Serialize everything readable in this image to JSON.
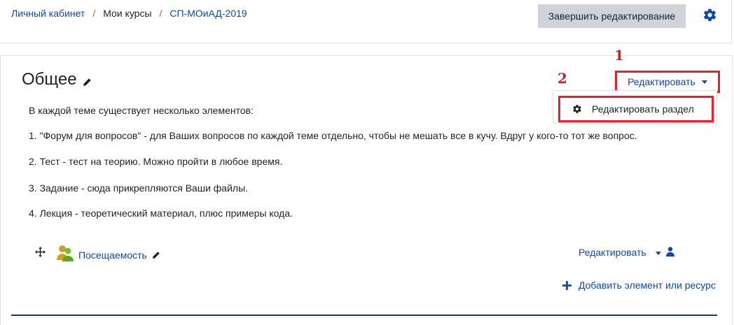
{
  "breadcrumb": {
    "items": [
      "Личный кабинет",
      "Мои курсы",
      "СП-МОиАД-2019"
    ],
    "separator": "/"
  },
  "header": {
    "finish_editing_label": "Завершить редактирование",
    "settings_icon": "gear-icon"
  },
  "section": {
    "title": "Общее",
    "edit_menu_label": "Редактировать",
    "dropdown": {
      "edit_section_label": "Редактировать раздел"
    },
    "summary": [
      "В каждой теме существует несколько элементов:",
      "1. \"Форум для вопросов\" - для Ваших вопросов по каждой теме отдельно, чтобы не мешать все в кучу. Вдруг у кого-то тот же вопрос.",
      "2. Тест - тест на теорию. Можно пройти в любое время.",
      "3. Задание - сюда прикрепляются Ваши файлы.",
      "4. Лекция - теоретический материал, плюс примеры кода."
    ]
  },
  "annotations": {
    "label_1": "1",
    "label_2": "2",
    "color": "#c81e28"
  },
  "activity": {
    "name": "Посещаемость",
    "edit_menu_label": "Редактировать",
    "icon": "attendance-icon"
  },
  "add_resource_label": "Добавить элемент или ресурс",
  "colors": {
    "link": "#0f47ad",
    "button_bg": "#ced4da",
    "highlight_border": "#e8202a"
  }
}
